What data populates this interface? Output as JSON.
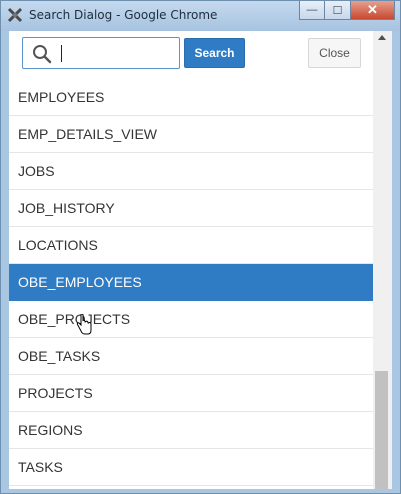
{
  "window": {
    "title": "Search Dialog - Google Chrome",
    "controls": {
      "minimize": "—",
      "maximize": "☐",
      "close": "✕"
    }
  },
  "toolbar": {
    "search_value": "",
    "search_button_label": "Search",
    "close_button_label": "Close"
  },
  "list": {
    "items": [
      {
        "label": "EMPLOYEES",
        "selected": false
      },
      {
        "label": "EMP_DETAILS_VIEW",
        "selected": false
      },
      {
        "label": "JOBS",
        "selected": false
      },
      {
        "label": "JOB_HISTORY",
        "selected": false
      },
      {
        "label": "LOCATIONS",
        "selected": false
      },
      {
        "label": "OBE_EMPLOYEES",
        "selected": true
      },
      {
        "label": "OBE_PROJECTS",
        "selected": false
      },
      {
        "label": "OBE_TASKS",
        "selected": false
      },
      {
        "label": "PROJECTS",
        "selected": false
      },
      {
        "label": "REGIONS",
        "selected": false
      },
      {
        "label": "TASKS",
        "selected": false
      }
    ]
  },
  "colors": {
    "accent": "#2f7bc4",
    "titlebar": "#a9c6e3"
  },
  "icons": {
    "app": "chrome-app-icon",
    "search": "search-icon",
    "cursor": "hand-cursor-icon"
  }
}
